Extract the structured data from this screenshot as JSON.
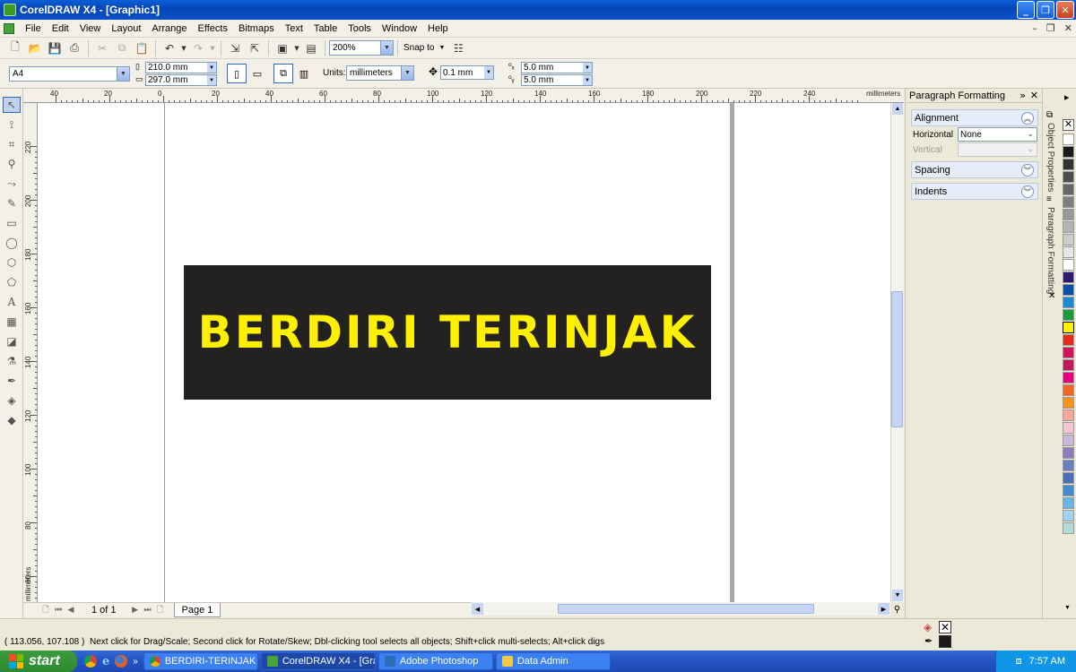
{
  "window": {
    "title": "CorelDRAW X4 - [Graphic1]"
  },
  "menu": {
    "items": [
      "File",
      "Edit",
      "View",
      "Layout",
      "Arrange",
      "Effects",
      "Bitmaps",
      "Text",
      "Table",
      "Tools",
      "Window",
      "Help"
    ]
  },
  "toolbar": {
    "zoom_value": "200%",
    "snap_to_label": "Snap to"
  },
  "property_bar": {
    "paper_size": "A4",
    "width": "210.0 mm",
    "height": "297.0 mm",
    "units_label": "Units:",
    "units_value": "millimeters",
    "nudge": "0.1 mm",
    "dup_x": "5.0 mm",
    "dup_y": "5.0 mm"
  },
  "ruler": {
    "unit_label": "millimeters",
    "h_labels": [
      "40",
      "20",
      "0",
      "20",
      "40",
      "60",
      "80",
      "100",
      "120",
      "140",
      "160",
      "180",
      "200",
      "220",
      "240"
    ],
    "v_labels": [
      "220",
      "200",
      "180",
      "160",
      "140",
      "120",
      "100",
      "80",
      "60"
    ]
  },
  "canvas": {
    "banner_text": "BERDIRI TERINJAK",
    "banner_bg": "#242220",
    "banner_fg": "#ffef00"
  },
  "page_nav": {
    "page_count": "1 of 1",
    "page_tab": "Page 1"
  },
  "docker": {
    "title": "Paragraph Formatting",
    "alignment_label": "Alignment",
    "horizontal_label": "Horizontal",
    "horizontal_value": "None",
    "vertical_label": "Vertical",
    "spacing_label": "Spacing",
    "indents_label": "Indents",
    "tab_object_properties": "Object Properties",
    "tab_paragraph_formatting": "Paragraph Formatting"
  },
  "palette": {
    "colors": [
      "#ffffff",
      "#1a1a1a",
      "#333333",
      "#4d4d4d",
      "#666666",
      "#808080",
      "#999999",
      "#b3b3b3",
      "#cccccc",
      "#e6e6e6",
      "#ffffff",
      "#2e1a6e",
      "#0a4fa8",
      "#1a8bd6",
      "#1a9a3a",
      "#fff200",
      "#e82b1a",
      "#d4145a",
      "#c2185b",
      "#e6007e",
      "#f26522",
      "#f7941d",
      "#f9a59a",
      "#f5c6d0",
      "#c8b7d9",
      "#8c7fb9",
      "#6b7fbf",
      "#4a6fb5",
      "#3f8ec9",
      "#6ab4e6",
      "#9fd3f0",
      "#b3dbd8"
    ]
  },
  "status": {
    "coords": "( 113.056, 107.108 )",
    "hint": "Next click for Drag/Scale; Second click for Rotate/Skew; Dbl-clicking tool selects all objects; Shift+click multi-selects; Alt+click digs"
  },
  "taskbar": {
    "start_label": "start",
    "tasks": [
      "BERDIRI-TERINJAK - ...",
      "CorelDRAW X4 - [Gra...",
      "Adobe Photoshop",
      "Data Admin"
    ],
    "clock": "7:57 AM"
  }
}
